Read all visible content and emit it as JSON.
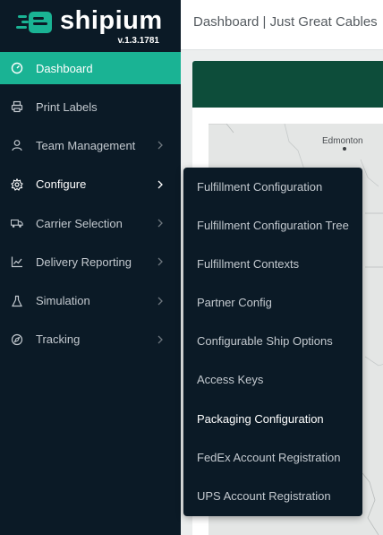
{
  "brand": {
    "name": "shipium",
    "version": "v.1.3.1781",
    "accent": "#1ab394",
    "sidebar_bg": "#0b1a26"
  },
  "header": {
    "title": "Dashboard | Just Great Cables"
  },
  "sidebar": {
    "items": [
      {
        "label": "Dashboard",
        "icon": "dashboard-gauge-icon",
        "active": true,
        "has_chevron": false
      },
      {
        "label": "Print Labels",
        "icon": "printer-icon",
        "has_chevron": false
      },
      {
        "label": "Team Management",
        "icon": "user-icon",
        "has_chevron": true
      },
      {
        "label": "Configure",
        "icon": "gear-icon",
        "has_chevron": true,
        "open": true
      },
      {
        "label": "Carrier Selection",
        "icon": "truck-icon",
        "has_chevron": true
      },
      {
        "label": "Delivery Reporting",
        "icon": "line-chart-icon",
        "has_chevron": true
      },
      {
        "label": "Simulation",
        "icon": "flask-icon",
        "has_chevron": true
      },
      {
        "label": "Tracking",
        "icon": "compass-icon",
        "has_chevron": true
      }
    ]
  },
  "configure_menu": {
    "items": [
      {
        "label": "Fulfillment Configuration"
      },
      {
        "label": "Fulfillment Configuration Tree"
      },
      {
        "label": "Fulfillment Contexts"
      },
      {
        "label": "Partner Config"
      },
      {
        "label": "Configurable Ship Options"
      },
      {
        "label": "Access Keys"
      },
      {
        "label": "Packaging Configuration",
        "highlighted": true
      },
      {
        "label": "FedEx Account Registration"
      },
      {
        "label": "UPS Account Registration"
      }
    ]
  },
  "map": {
    "city_label": "Edmonton"
  }
}
